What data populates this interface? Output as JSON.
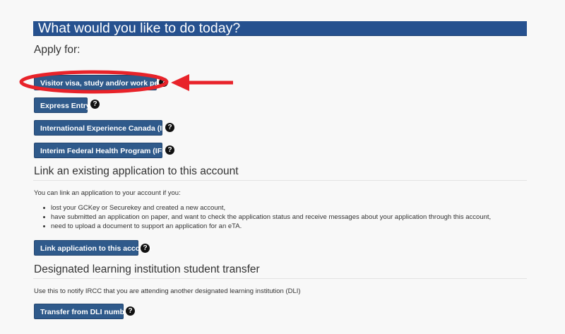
{
  "header": {
    "title": "What would you like to do today?"
  },
  "apply": {
    "heading": "Apply for:",
    "buttons": [
      {
        "label": "Visitor visa, study and/or work permit"
      },
      {
        "label": "Express Entry"
      },
      {
        "label": "International Experience Canada (IEC)"
      },
      {
        "label": "Interim Federal Health Program (IFHP)"
      }
    ]
  },
  "link": {
    "heading": "Link an existing application to this account",
    "intro": "You can link an application to your account if you:",
    "bullets": [
      "lost your GCKey or Securekey and created a new account,",
      "have submitted an application on paper, and want to check the application status and receive messages about your application through this account,",
      "need to upload a document to support an application for an eTA."
    ],
    "button": "Link application to this account"
  },
  "dli": {
    "heading": "Designated learning institution student transfer",
    "intro": "Use this to notify IRCC that you are attending another designated learning institution (DLI)",
    "button": "Transfer from DLI number"
  },
  "help_icon": {
    "glyph": "?",
    "icon": "question-circle-icon"
  },
  "annotation": {
    "color": "#e8232a"
  }
}
